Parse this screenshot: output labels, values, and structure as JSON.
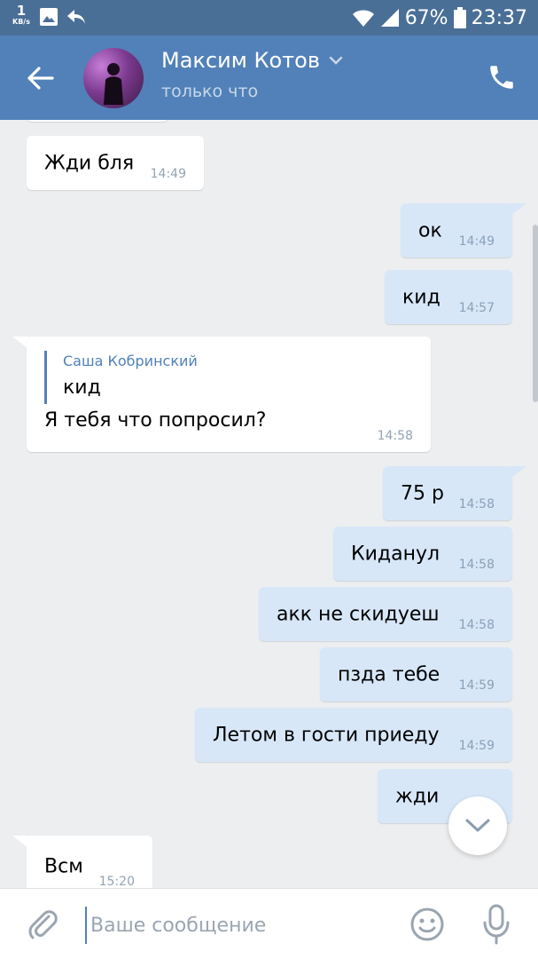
{
  "status_bar": {
    "net_speed": "1",
    "net_unit": "KB/s",
    "battery": "67%",
    "time": "23:37"
  },
  "header": {
    "contact_name": "Максим Котов",
    "contact_status": "только что"
  },
  "messages": [
    {
      "text": "Жди бля",
      "time": "14:49",
      "dir": "in"
    },
    {
      "text": "ок",
      "time": "14:49",
      "dir": "out"
    },
    {
      "text": "кид",
      "time": "14:57",
      "dir": "out"
    },
    {
      "reply_author": "Саша Кобринский",
      "reply_text": "кид",
      "text": "Я тебя что попросил?",
      "time": "14:58",
      "dir": "in"
    },
    {
      "text": "75 р",
      "time": "14:58",
      "dir": "out"
    },
    {
      "text": "Киданул",
      "time": "14:58",
      "dir": "out"
    },
    {
      "text": "акк не скидуеш",
      "time": "14:58",
      "dir": "out"
    },
    {
      "text": "пзда тебе",
      "time": "14:59",
      "dir": "out"
    },
    {
      "text": "Летом в гости приеду",
      "time": "14:59",
      "dir": "out"
    },
    {
      "text": "жди",
      "time": "",
      "dir": "out"
    },
    {
      "text": "Всм",
      "time": "15:20",
      "dir": "in"
    }
  ],
  "composer": {
    "placeholder": "Ваше сообщение"
  },
  "colors": {
    "header": "#5181b8",
    "status_bar": "#4a6f97",
    "out_bubble": "#d8e7f8",
    "in_bubble": "#ffffff",
    "background": "#edeef0"
  }
}
